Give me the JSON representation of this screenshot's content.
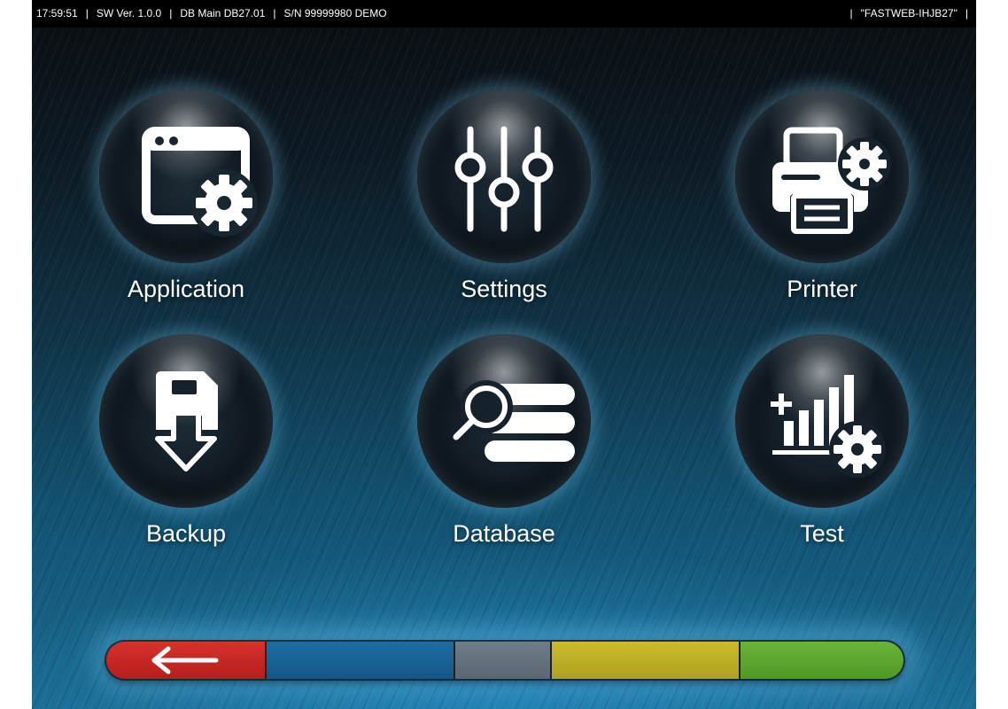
{
  "status_bar": {
    "time": "17:59:51",
    "separator": "|",
    "sw_version": "SW Ver. 1.0.0",
    "db_main": "DB Main DB27.01",
    "serial": "S/N 99999980 DEMO",
    "network": "\"FASTWEB-IHJB27\""
  },
  "menu": {
    "tiles": [
      {
        "label": "Application",
        "icon": "application-gear-icon"
      },
      {
        "label": "Settings",
        "icon": "sliders-icon"
      },
      {
        "label": "Printer",
        "icon": "printer-gear-icon"
      },
      {
        "label": "Backup",
        "icon": "backup-download-icon"
      },
      {
        "label": "Database",
        "icon": "database-search-icon"
      },
      {
        "label": "Test",
        "icon": "test-chart-gear-icon"
      }
    ]
  },
  "bottom_bar": {
    "buttons": [
      {
        "color": "#c8282a",
        "icon": "back-arrow-icon"
      },
      {
        "color": "#1a629a",
        "icon": ""
      },
      {
        "color": "#66737e",
        "icon": ""
      },
      {
        "color": "#bdb027",
        "icon": ""
      },
      {
        "color": "#5ea830",
        "icon": ""
      }
    ]
  }
}
